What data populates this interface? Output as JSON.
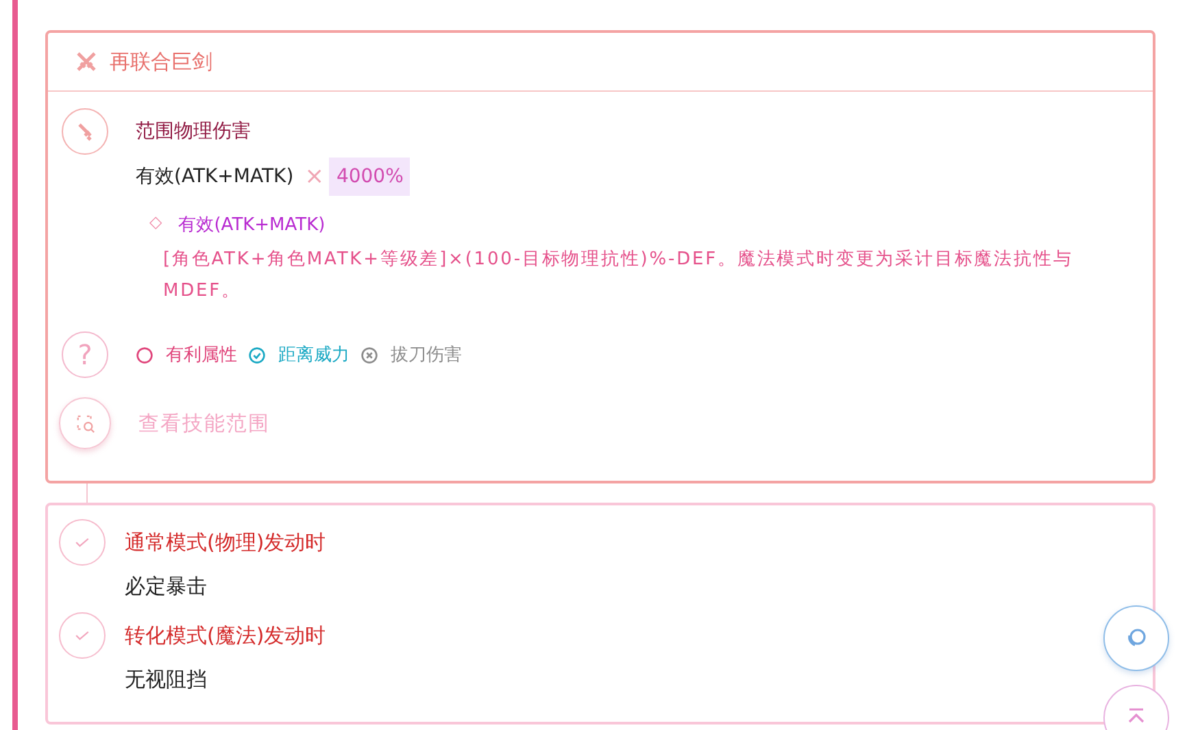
{
  "skill": {
    "title": "再联合巨剑",
    "damage": {
      "type": "范围物理伤害",
      "formula": "有效(ATK+MATK)",
      "times": "×",
      "multiplier": "4000%",
      "note": {
        "marker": "◇",
        "title": "有效(ATK+MATK)",
        "text": "[角色ATK+角色MATK+等级差]×(100-目标物理抗性)%-DEF。魔法模式时变更为采计目标魔法抗性与MDEF。"
      }
    },
    "help_icon": "?",
    "tags": [
      {
        "label": "有利属性",
        "kind": "neutral"
      },
      {
        "label": "距离威力",
        "kind": "yes"
      },
      {
        "label": "拔刀伤害",
        "kind": "no"
      }
    ],
    "range_link": "查看技能范围"
  },
  "effects": [
    {
      "condition": "通常模式(物理)发动时",
      "result": "必定暴击"
    },
    {
      "condition": "转化模式(魔法)发动时",
      "result": "无视阻挡"
    }
  ]
}
